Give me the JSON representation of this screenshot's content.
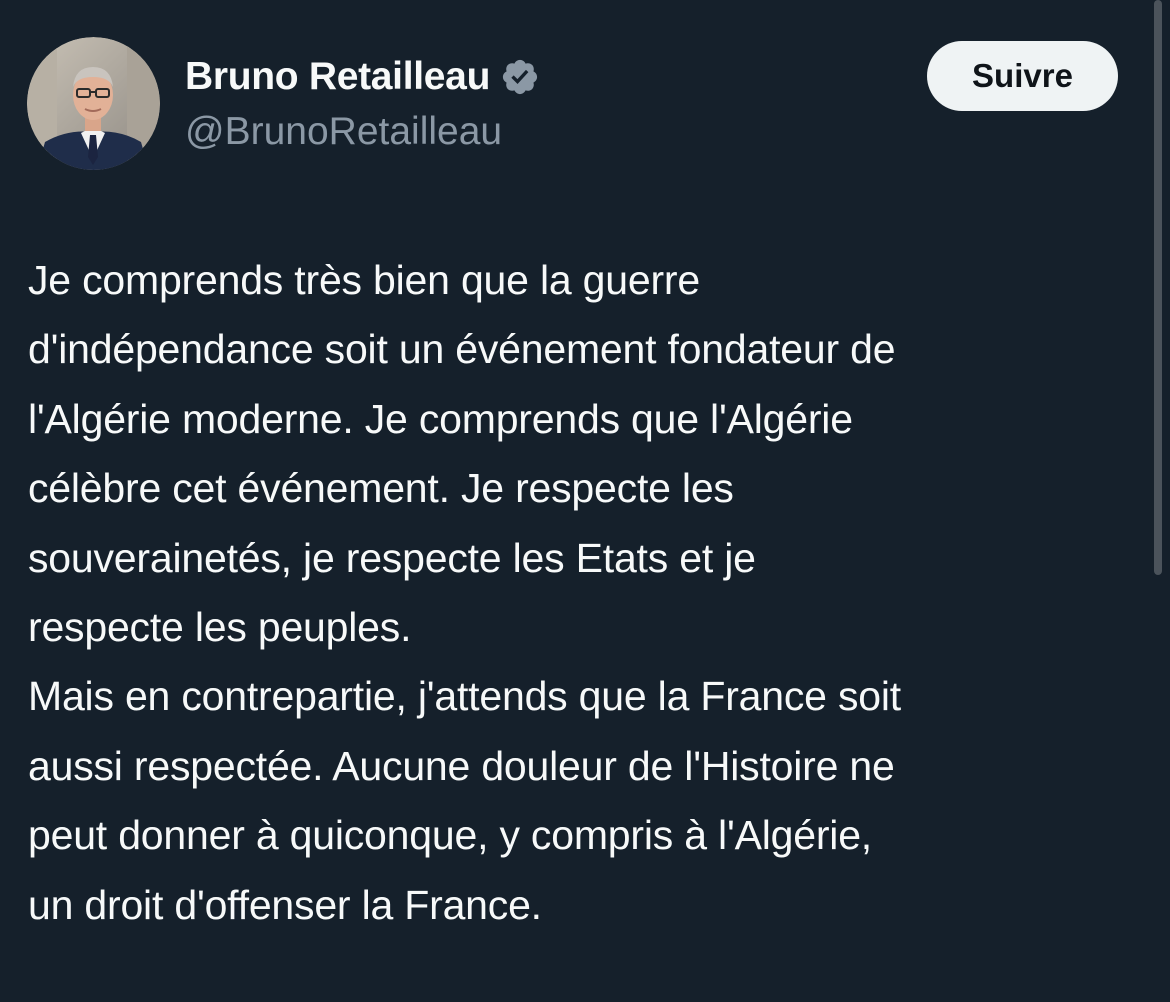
{
  "author": {
    "display_name": "Bruno Retailleau",
    "handle": "@BrunoRetailleau",
    "verified_icon": "verified-badge-icon",
    "avatar": "profile-photo"
  },
  "actions": {
    "follow_label": "Suivre"
  },
  "tweet": {
    "lines": [
      "Je comprends très bien que la guerre",
      "d'indépendance soit un événement fondateur de",
      "l'Algérie moderne. Je comprends que l'Algérie",
      "célèbre cet événement. Je respecte les",
      "souverainetés, je respecte les Etats et je",
      "respecte les peuples.",
      "Mais en contrepartie, j'attends que la France soit",
      "aussi respectée. Aucune douleur de l'Histoire ne",
      "peut donner à quiconque, y compris à l'Algérie,",
      "un droit d'offenser la France."
    ]
  },
  "colors": {
    "background": "#15202b",
    "text_primary": "#f7f9f9",
    "text_secondary": "#8b98a5",
    "button_bg": "#eff3f4",
    "button_text": "#0f1419",
    "badge": "#8b98a5"
  }
}
